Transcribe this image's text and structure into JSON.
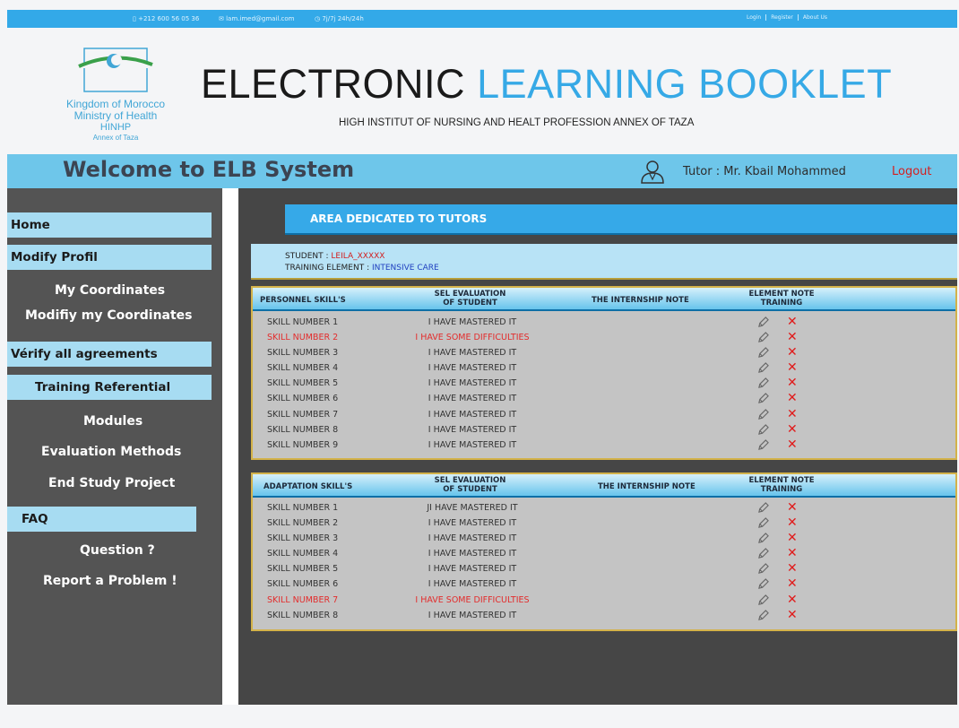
{
  "topbar": {
    "phone": "+212 600 56 05 36",
    "email": "lam.imed@gmail.com",
    "hours": "7j/7j 24h/24h",
    "links": [
      "Login",
      "Register",
      "About Us"
    ]
  },
  "header": {
    "logo_lines": [
      "Kingdom of Morocco",
      "Ministry of Health",
      "HINHP",
      "Annex of Taza"
    ],
    "title_dark": "ELECTRONIC",
    "title_blue": "LEARNING BOOKLET",
    "subtitle": "HIGH INSTITUT OF NURSING AND HEALT PROFESSION ANNEX OF TAZA"
  },
  "welcome": {
    "title": "Welcome to ELB System",
    "tutor": "Tutor : Mr. Kbail Mohammed",
    "logout": "Logout"
  },
  "sidebar": {
    "home": "Home",
    "modify_profil": "Modify Profil",
    "my_coordinates": "My Coordinates",
    "modify_coordinates": "Modifiy my Coordinates",
    "verify": "Vérify all agreements",
    "training_ref": "Training Referential",
    "modules": "Modules",
    "evaluation": "Evaluation Methods",
    "end_study": "End Study Project",
    "faq": "FAQ",
    "question": "Question ?",
    "report": "Report a Problem !"
  },
  "main": {
    "area_title": "AREA DEDICATED TO TUTORS",
    "student_label": "STUDENT : ",
    "student_value": "LEILA_XXXXX",
    "training_label": "TRAINING ELEMENT : ",
    "training_value": "INTENSIVE CARE"
  },
  "personnel": {
    "headers": {
      "skills": "PERSONNEL SKILL'S",
      "sel1": "SEL EVALUATION",
      "sel2": "OF STUDENT",
      "note": "THE INTERNSHIP NOTE",
      "el1": "ELEMENT NOTE",
      "el2": "TRAINING"
    },
    "rows": [
      {
        "skill": "SKILL NUMBER 1",
        "eval": "I HAVE MASTERED IT"
      },
      {
        "skill": "SKILL NUMBER 2",
        "eval": "I HAVE SOME DIFFICULTIES"
      },
      {
        "skill": "SKILL NUMBER 3",
        "eval": "I HAVE MASTERED IT"
      },
      {
        "skill": "SKILL NUMBER 4",
        "eval": "I HAVE MASTERED IT"
      },
      {
        "skill": "SKILL NUMBER 5",
        "eval": "I HAVE MASTERED IT"
      },
      {
        "skill": "SKILL NUMBER 6",
        "eval": "I HAVE MASTERED IT"
      },
      {
        "skill": "SKILL NUMBER 7",
        "eval": "I HAVE MASTERED IT"
      },
      {
        "skill": "SKILL NUMBER 8",
        "eval": "I HAVE MASTERED IT"
      },
      {
        "skill": "SKILL NUMBER 9",
        "eval": "I HAVE MASTERED IT"
      }
    ]
  },
  "adaptation": {
    "headers": {
      "skills": "ADAPTATION SKILL'S",
      "sel1": "SEL EVALUATION",
      "sel2": "OF STUDENT",
      "note": "THE INTERNSHIP NOTE",
      "el1": "ELEMENT NOTE",
      "el2": "TRAINING"
    },
    "rows": [
      {
        "skill": "SKILL NUMBER 1",
        "eval": "JI HAVE MASTERED IT"
      },
      {
        "skill": "SKILL NUMBER 2",
        "eval": "I HAVE MASTERED IT"
      },
      {
        "skill": "SKILL NUMBER 3",
        "eval": "I HAVE MASTERED IT"
      },
      {
        "skill": "SKILL NUMBER 4",
        "eval": "I HAVE MASTERED IT"
      },
      {
        "skill": "SKILL NUMBER 5",
        "eval": "I HAVE MASTERED IT"
      },
      {
        "skill": "SKILL NUMBER 6",
        "eval": "I HAVE MASTERED IT"
      },
      {
        "skill": "SKILL NUMBER 7",
        "eval": "I HAVE SOME DIFFICULTIES"
      },
      {
        "skill": "SKILL NUMBER 8",
        "eval": "I HAVE MASTERED IT"
      }
    ]
  },
  "colors": {
    "accent": "#36a9e8",
    "difficulty": "#e32c2c",
    "delete": "#e01b1b"
  },
  "icons": {
    "row_edit": "pencil-icon",
    "row_delete": "delete-x-icon",
    "tutor": "user-icon"
  }
}
